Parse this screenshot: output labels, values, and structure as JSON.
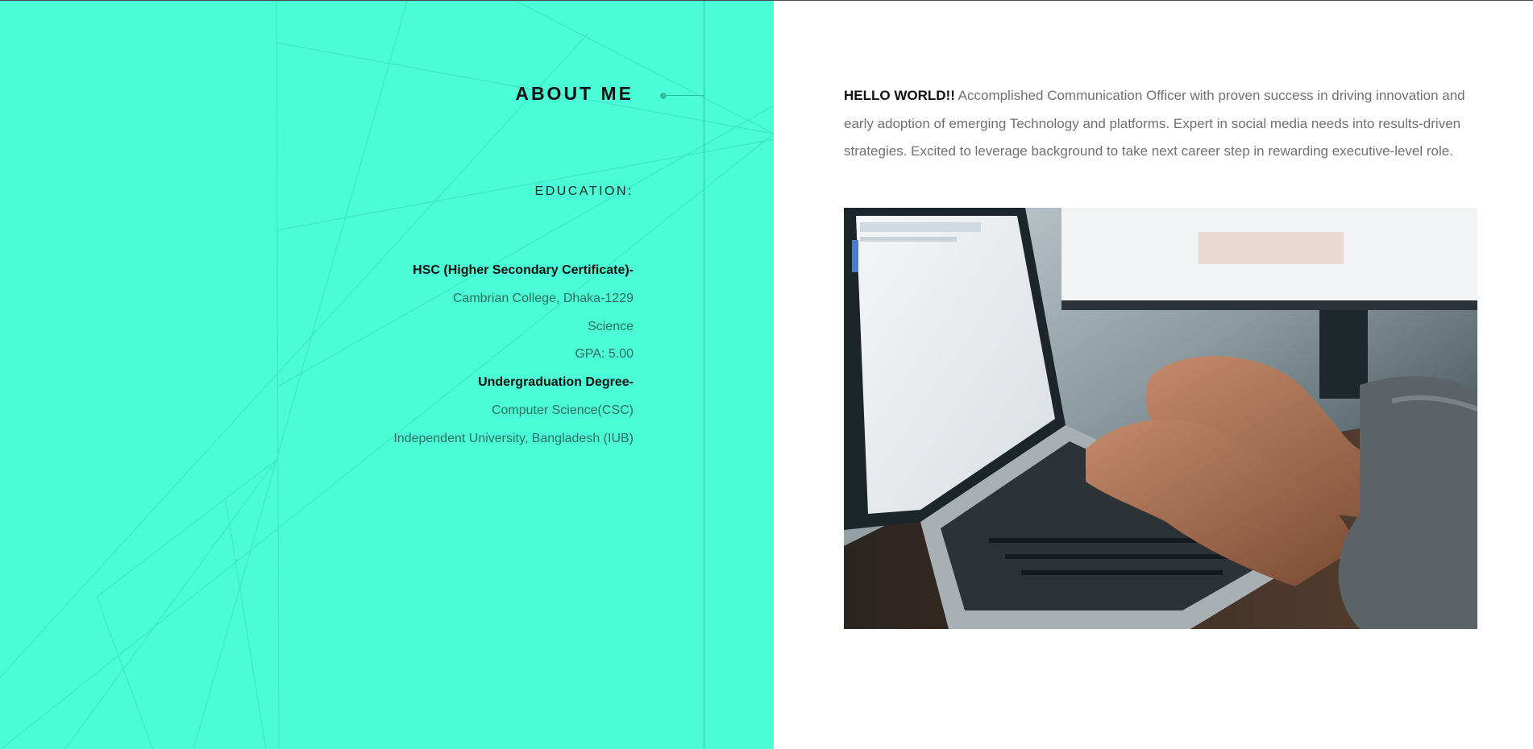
{
  "about": {
    "title": "ABOUT ME",
    "education_heading": "EDUCATION:",
    "education_lines": [
      {
        "text": "HSC (Higher Secondary Certificate)-",
        "bold": true
      },
      {
        "text": "Cambrian College, Dhaka-1229",
        "bold": false
      },
      {
        "text": "Science",
        "bold": false
      },
      {
        "text": "GPA: 5.00",
        "bold": false
      },
      {
        "text": "Undergraduation Degree-",
        "bold": true
      },
      {
        "text": "Computer Science(CSC)",
        "bold": false
      },
      {
        "text": "Independent University, Bangladesh (IUB)",
        "bold": false
      }
    ]
  },
  "intro": {
    "lead": "HELLO WORLD!!",
    "body": " Accomplished Communication Officer with proven success in driving innovation and early adoption of emerging Technology and platforms. Expert in social media needs into results-driven strategies. Excited to leverage background to take next career step in rewarding executive-level role."
  },
  "photo": {
    "icon": "laptop-typing-photo"
  },
  "colors": {
    "accent": "#4bfdd6",
    "timeline": "#2fbf9f"
  }
}
